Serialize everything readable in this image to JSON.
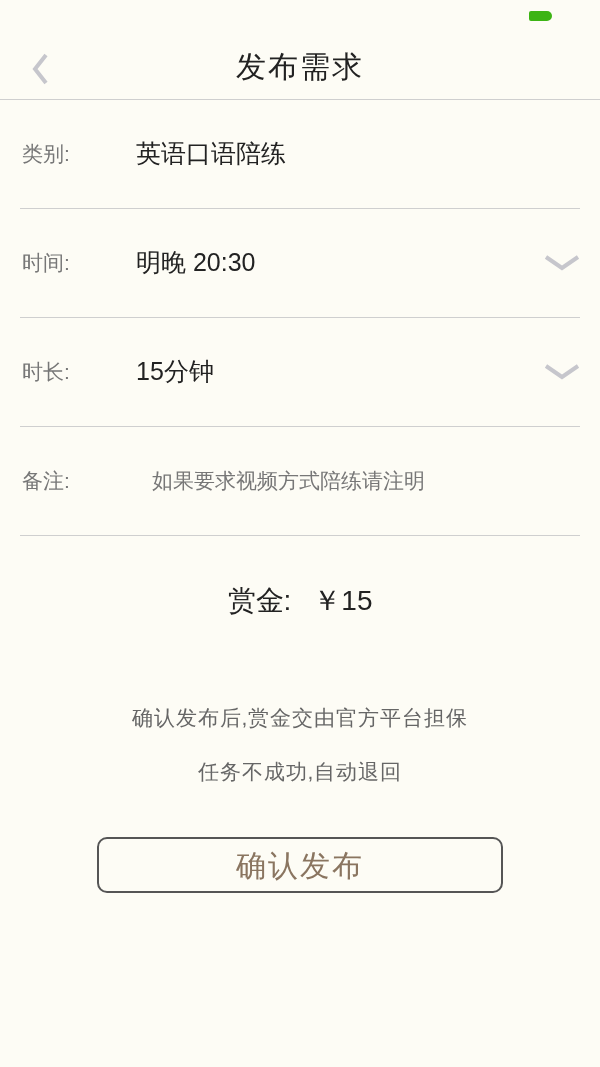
{
  "nav": {
    "title": "发布需求"
  },
  "form_rows": [
    {
      "kind": "static",
      "label": "类别:",
      "value": "英语口语陪练"
    },
    {
      "kind": "select",
      "label": "时间:",
      "value": "明晚 20:30"
    },
    {
      "kind": "select",
      "label": "时长:",
      "value": "15分钟"
    },
    {
      "kind": "input",
      "label": "备注:",
      "placeholder": "如果要求视频方式陪练请注明"
    }
  ],
  "reward": {
    "label": "赏金:",
    "value": "￥15"
  },
  "notice_lines": [
    "确认发布后,赏金交由官方平台担保",
    "任务不成功,自动退回"
  ],
  "submit_button": "确认发布"
}
